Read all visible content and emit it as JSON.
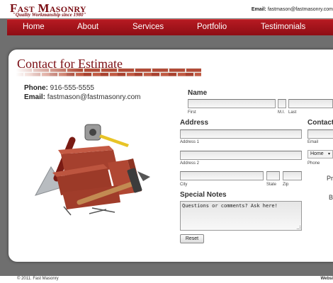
{
  "header": {
    "logo_title": "Fast Masonry",
    "logo_tagline": "\"Quality Workmanship since 1980\"",
    "email_label": "Email:",
    "email_value": "fastmason@fastmasonry.com"
  },
  "nav": {
    "items": [
      {
        "label": "Home"
      },
      {
        "label": "About"
      },
      {
        "label": "Services"
      },
      {
        "label": "Portfolio"
      },
      {
        "label": "Testimonials"
      }
    ]
  },
  "main": {
    "title": "Contact for Estimate",
    "phone_label": "Phone:",
    "phone_value": "916-555-5555",
    "email_label": "Email:",
    "email_value": "fastmason@fastmasonry.com"
  },
  "form": {
    "name_heading": "Name",
    "first_label": "First",
    "mi_label": "M.I.",
    "last_label": "Last",
    "address_heading": "Address",
    "address1_label": "Address 1",
    "address2_label": "Address 2",
    "city_label": "City",
    "state_label": "State",
    "zip_label": "Zip",
    "contact_heading": "Contact",
    "contact_email_label": "Email",
    "phone_type_selected": "Home",
    "phone_label": "Phone",
    "side_text_1": "Pr",
    "side_text_2": "B",
    "notes_heading": "Special Notes",
    "notes_placeholder": "Questions or comments? Ask here!",
    "reset_label": "Reset"
  },
  "footer": {
    "copyright": "© 2011. Fast Masonry",
    "right_text": "Websi"
  }
}
